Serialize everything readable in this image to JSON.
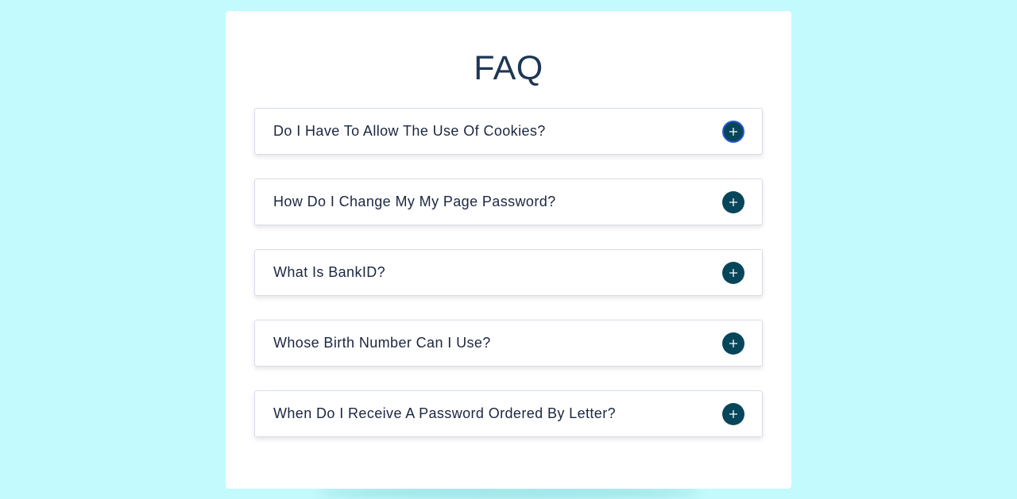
{
  "title": "FAQ",
  "faq": {
    "items": [
      {
        "question": "Do I Have To Allow The Use Of Cookies?",
        "icon": "plus-icon"
      },
      {
        "question": "How Do I Change My My Page Password?",
        "icon": "plus-icon"
      },
      {
        "question": "What Is BankID?",
        "icon": "plus-icon"
      },
      {
        "question": "Whose Birth Number Can I Use?",
        "icon": "plus-icon"
      },
      {
        "question": "When Do I Receive A Password Ordered By Letter?",
        "icon": "plus-icon"
      }
    ]
  },
  "colors": {
    "background": "#c2fafd",
    "card": "#ffffff",
    "title": "#1e3654",
    "question_text": "#1b2640",
    "toggle_button": "#07465a",
    "focus_ring": "#2a56d6"
  }
}
